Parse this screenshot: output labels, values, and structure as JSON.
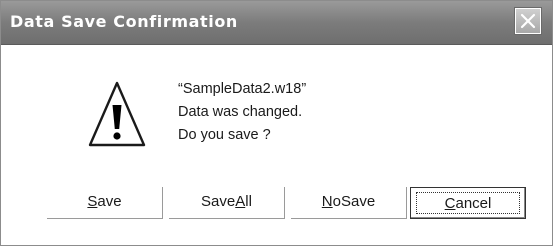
{
  "window": {
    "title": "Data Save Confirmation"
  },
  "message": {
    "filename": "“SampleData2.w18”",
    "line2": "Data was changed.",
    "line3": "Do you save ?"
  },
  "buttons": {
    "save": {
      "mnemonic": "S",
      "rest": "ave"
    },
    "save_all": {
      "prefix": "Save",
      "mnemonic": "A",
      "rest": "ll"
    },
    "no_save": {
      "mnemonic": "N",
      "rest": "oSave"
    },
    "cancel": {
      "mnemonic": "C",
      "rest": "ancel"
    }
  },
  "icons": {
    "close": "close-icon",
    "warning": "warning-icon"
  }
}
